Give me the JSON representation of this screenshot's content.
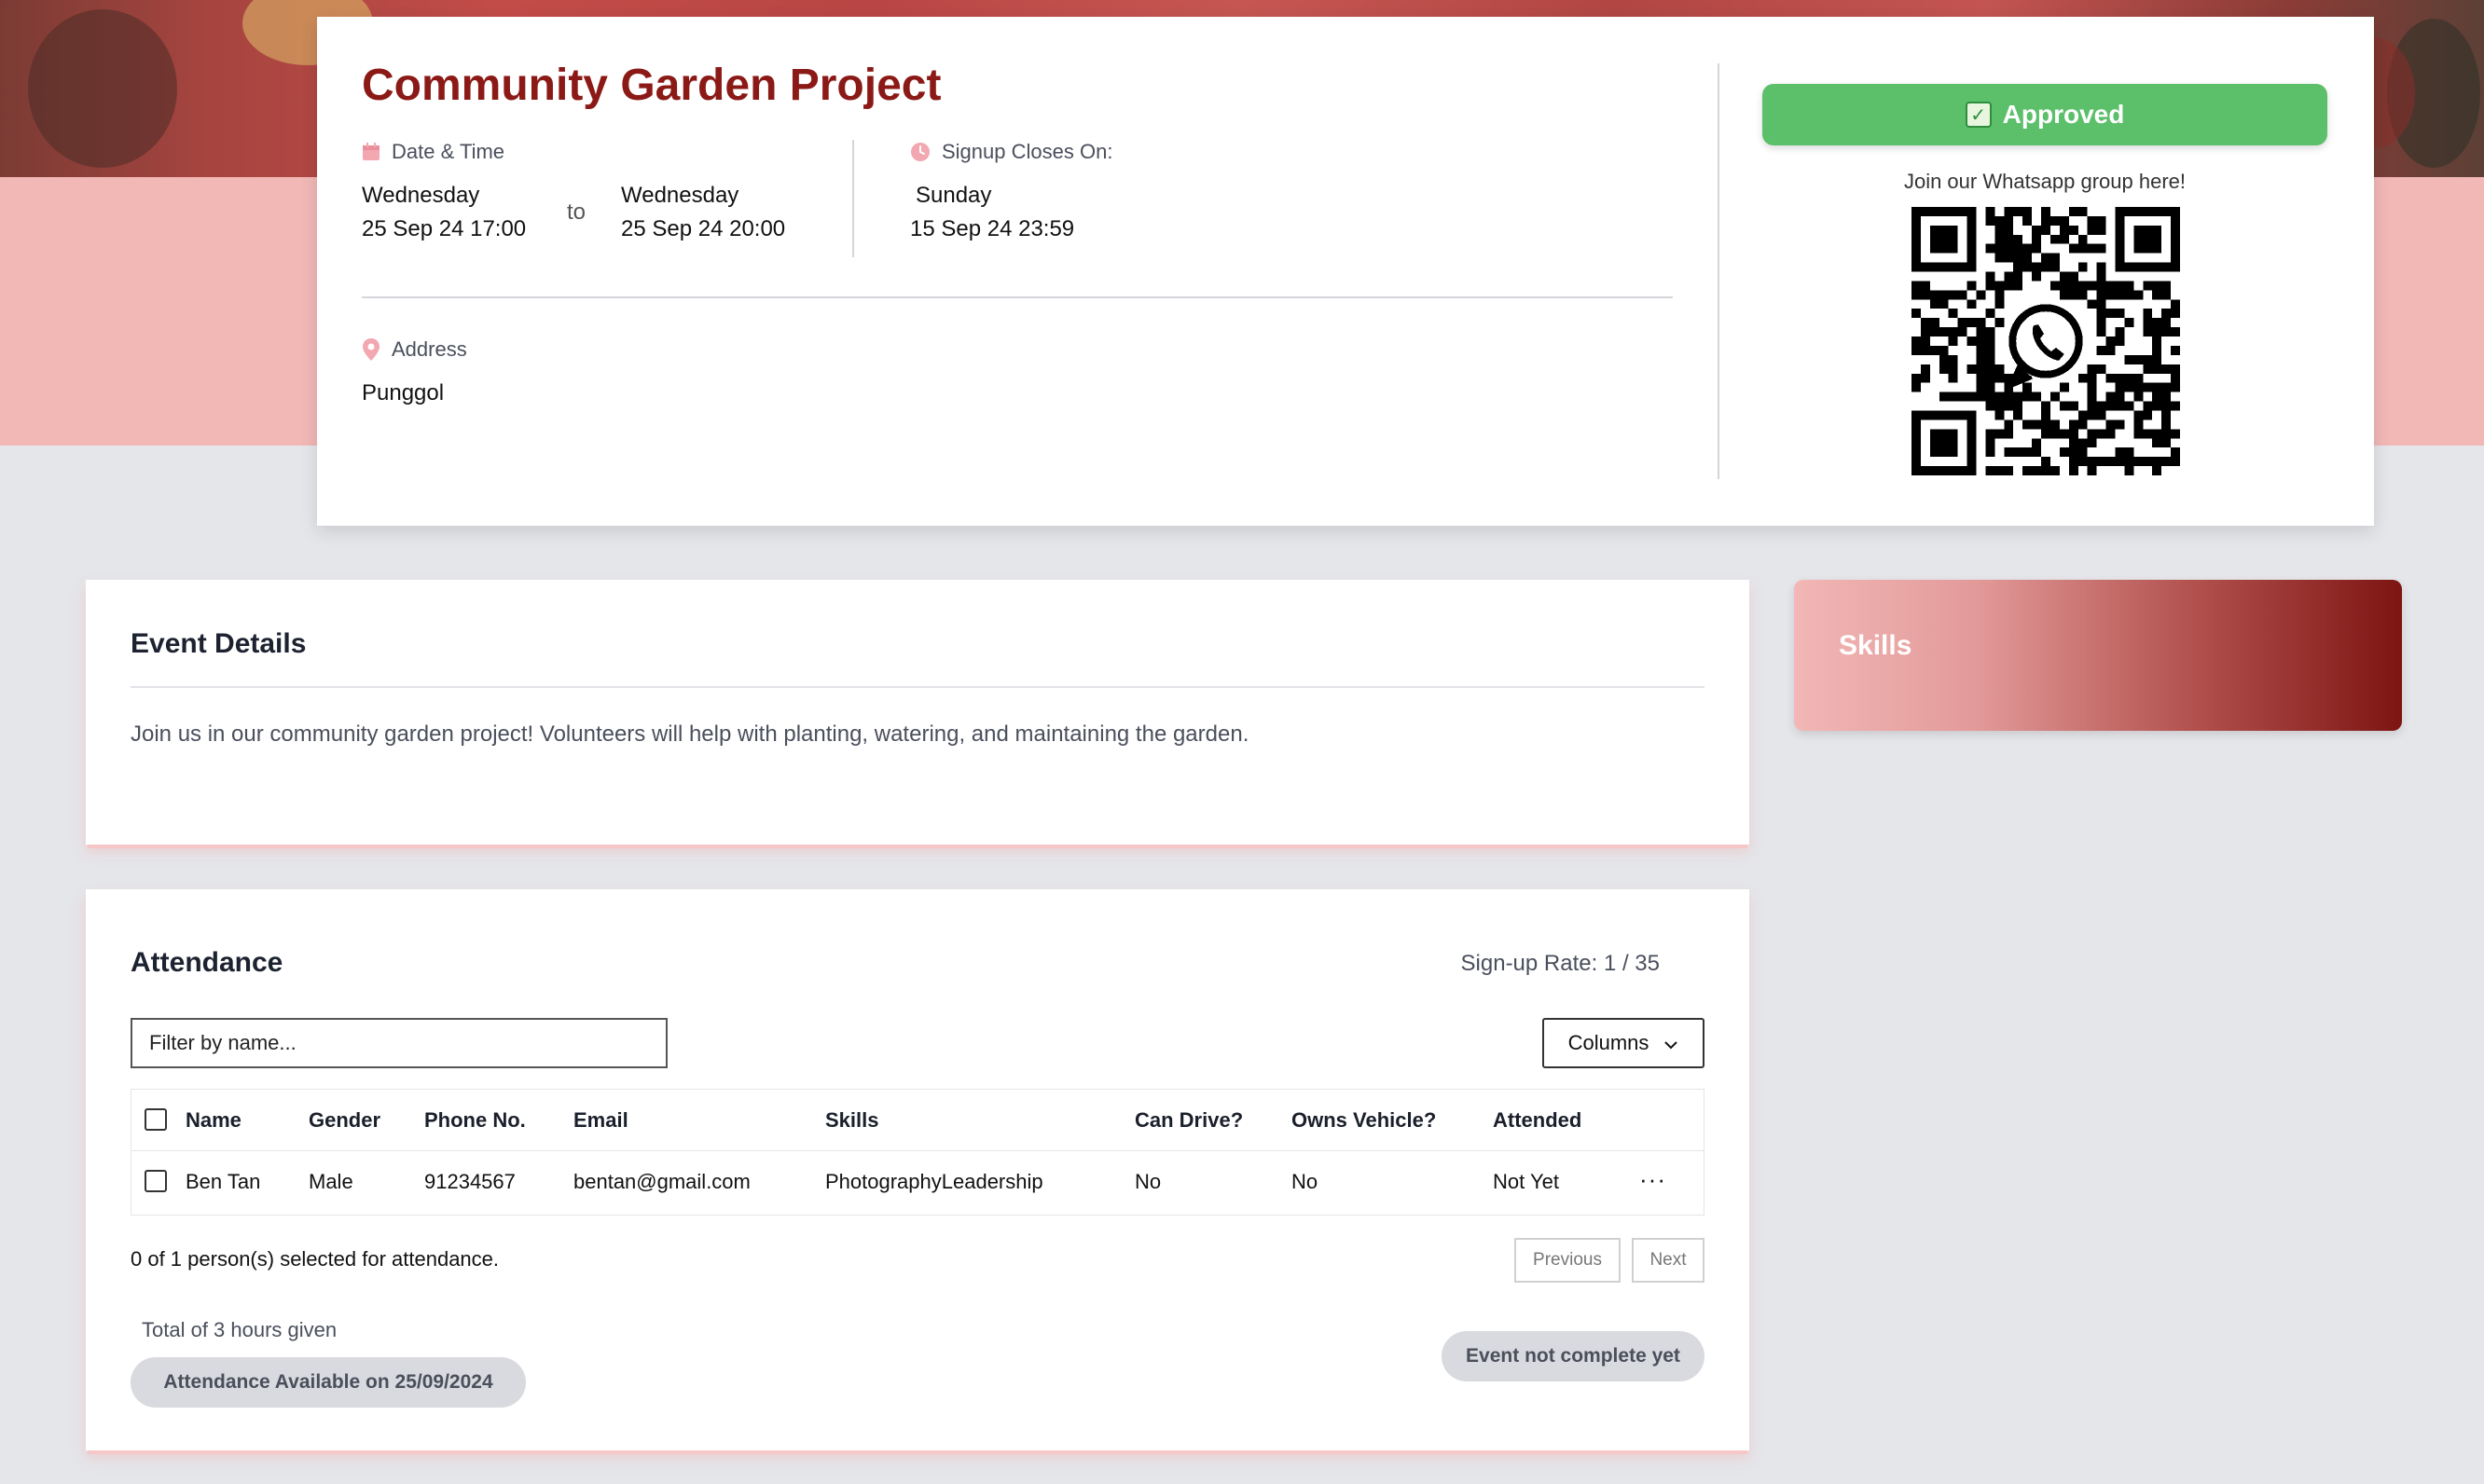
{
  "event": {
    "title": "Community Garden Project",
    "date_time_label": "Date & Time",
    "start_day": "Wednesday",
    "start_datetime": "25 Sep 24 17:00",
    "to_label": "to",
    "end_day": "Wednesday",
    "end_datetime": "25 Sep 24 20:00",
    "signup_label": "Signup Closes On:",
    "signup_day": "Sunday",
    "signup_datetime": "15 Sep 24 23:59",
    "address_label": "Address",
    "address": "Punggol"
  },
  "status": {
    "label": "Approved",
    "check_glyph": "✓",
    "color": "#5cbf6a"
  },
  "whatsapp": {
    "text": "Join our Whatsapp group here!"
  },
  "details": {
    "title": "Event Details",
    "description": "Join us in our community garden project! Volunteers will help with planting, watering, and maintaining the garden."
  },
  "skills": {
    "title": "Skills"
  },
  "attendance": {
    "title": "Attendance",
    "signup_rate": "Sign-up Rate: 1 / 35",
    "filter_placeholder": "Filter by name...",
    "columns_label": "Columns",
    "headers": [
      "Name",
      "Gender",
      "Phone No.",
      "Email",
      "Skills",
      "Can Drive?",
      "Owns Vehicle?",
      "Attended"
    ],
    "rows": [
      [
        "Ben Tan",
        "Male",
        "91234567",
        "bentan@gmail.com",
        "PhotographyLeadership",
        "No",
        "No",
        "Not Yet"
      ]
    ],
    "row_actions_glyph": "···",
    "selected_text": "0 of 1 person(s) selected for attendance.",
    "previous_label": "Previous",
    "next_label": "Next",
    "hours_text": "Total of 3 hours given",
    "available_label": "Attendance Available on 25/09/2024",
    "not_complete_label": "Event not complete yet"
  },
  "colors": {
    "brand": "#8b1a17",
    "hero_pink": "#f1b8b6",
    "page_bg": "#e5e6ea",
    "icon_pink": "#f2a7b1"
  }
}
